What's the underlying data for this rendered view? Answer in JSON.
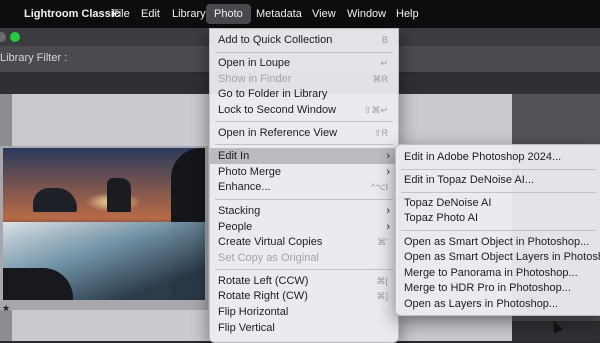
{
  "menubar": {
    "apple_icon": "apple-icon",
    "app_name": "Lightroom Classic",
    "items": [
      "File",
      "Edit",
      "Library",
      "Photo",
      "Metadata",
      "View",
      "Window",
      "Help"
    ],
    "active": "Photo"
  },
  "filter_bar": {
    "label": "Library Filter :"
  },
  "thumbnail": {
    "rating": "★"
  },
  "photo_menu": {
    "items": [
      {
        "label": "Add to Quick Collection",
        "shortcut": "B"
      },
      {
        "label": "Open in Loupe",
        "shortcut": "↵"
      },
      {
        "label": "Show in Finder",
        "shortcut": "⌘R",
        "disabled": true
      },
      {
        "label": "Go to Folder in Library",
        "shortcut": ""
      },
      {
        "label": "Lock to Second Window",
        "shortcut": "⇧⌘↵"
      },
      {
        "label": "Open in Reference View",
        "shortcut": "⇧R"
      },
      {
        "label": "Edit In",
        "submenu": true,
        "highlighted": true
      },
      {
        "label": "Photo Merge",
        "submenu": true
      },
      {
        "label": "Enhance...",
        "shortcut": "^⌥I"
      },
      {
        "label": "Stacking",
        "submenu": true
      },
      {
        "label": "People",
        "submenu": true
      },
      {
        "label": "Create Virtual Copies",
        "shortcut": "⌘'"
      },
      {
        "label": "Set Copy as Original",
        "disabled": true
      },
      {
        "label": "Rotate Left (CCW)",
        "shortcut": "⌘["
      },
      {
        "label": "Rotate Right (CW)",
        "shortcut": "⌘]"
      },
      {
        "label": "Flip Horizontal",
        "shortcut": ""
      },
      {
        "label": "Flip Vertical",
        "shortcut": ""
      }
    ]
  },
  "edit_in_submenu": {
    "items": [
      "Edit in Adobe Photoshop 2024...",
      "Edit in Topaz DeNoise AI...",
      "Topaz DeNoise AI",
      "Topaz Photo AI",
      "Open as Smart Object in Photoshop...",
      "Open as Smart Object Layers in Photoshop...",
      "Merge to Panorama in Photoshop...",
      "Merge to HDR Pro in Photoshop...",
      "Open as Layers in Photoshop..."
    ]
  },
  "colors": {
    "menubar_bg": "#0d0d0f",
    "menu_bg": "#ececf0",
    "highlight": "#a8a8b0",
    "close_light": "#27c93f"
  }
}
